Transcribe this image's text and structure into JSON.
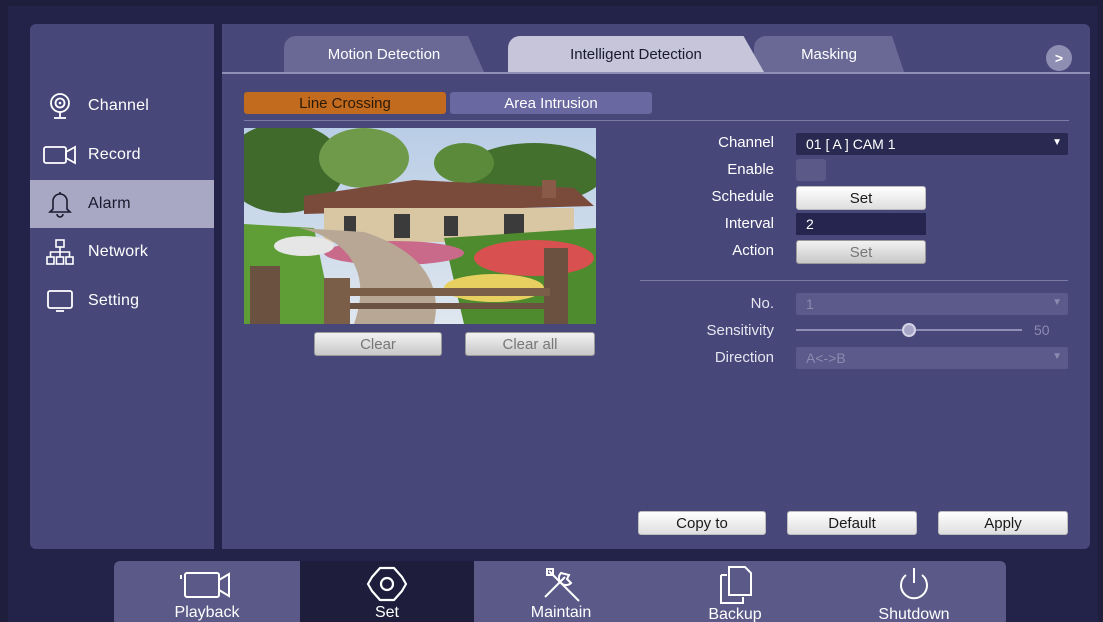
{
  "sidebar": {
    "items": [
      {
        "label": "Channel",
        "icon": "camera-eye-icon"
      },
      {
        "label": "Record",
        "icon": "video-camera-icon"
      },
      {
        "label": "Alarm",
        "icon": "bell-icon",
        "active": true
      },
      {
        "label": "Network",
        "icon": "network-icon"
      },
      {
        "label": "Setting",
        "icon": "monitor-icon"
      }
    ]
  },
  "tabs": [
    {
      "label": "Motion Detection"
    },
    {
      "label": "Intelligent Detection",
      "active": true
    },
    {
      "label": "Masking"
    }
  ],
  "tab_next_label": ">",
  "subtabs": [
    {
      "label": "Line Crossing",
      "active": true
    },
    {
      "label": "Area Intrusion"
    }
  ],
  "preview_buttons": {
    "clear": "Clear",
    "clear_all": "Clear all"
  },
  "form": {
    "channel": {
      "label": "Channel",
      "value": "01 [ A ] CAM 1"
    },
    "enable": {
      "label": "Enable",
      "checked": false
    },
    "schedule": {
      "label": "Schedule",
      "button": "Set"
    },
    "interval": {
      "label": "Interval",
      "value": "2"
    },
    "action": {
      "label": "Action",
      "button": "Set"
    },
    "no": {
      "label": "No.",
      "value": "1"
    },
    "sensitivity": {
      "label": "Sensitivity",
      "value": "50",
      "level": 0.5
    },
    "direction": {
      "label": "Direction",
      "value": "A<->B"
    }
  },
  "footer_buttons": {
    "copy_to": "Copy to",
    "default": "Default",
    "apply": "Apply"
  },
  "bottombar": [
    {
      "label": "Playback",
      "icon": "video-camera-icon"
    },
    {
      "label": "Set",
      "icon": "gear-icon",
      "active": true
    },
    {
      "label": "Maintain",
      "icon": "tools-icon"
    },
    {
      "label": "Backup",
      "icon": "copy-icon"
    },
    {
      "label": "Shutdown",
      "icon": "power-icon"
    }
  ],
  "colors": {
    "background": "#23234a",
    "panel": "#48477a",
    "accent_orange": "#c26a1d",
    "active_sidebar": "#a8a7c4"
  }
}
